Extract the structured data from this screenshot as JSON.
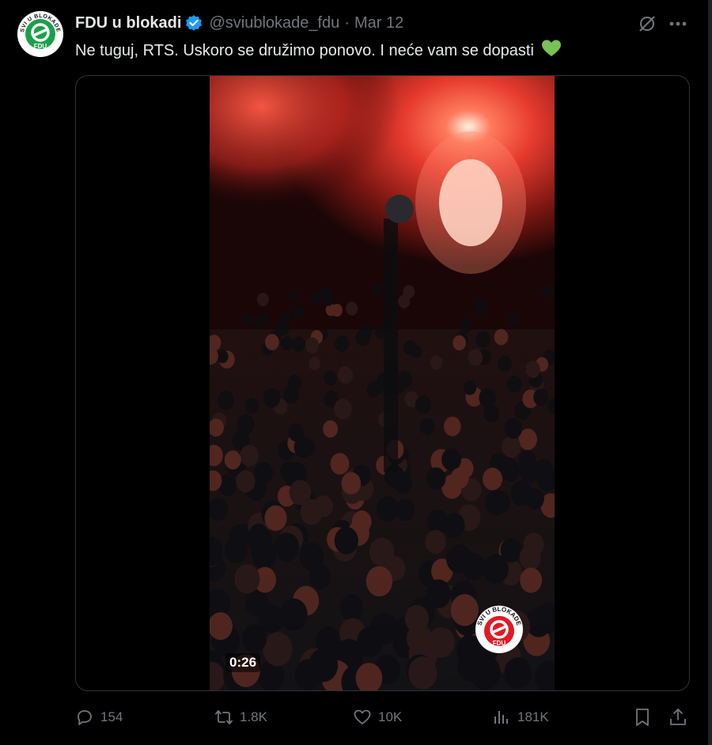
{
  "post": {
    "author_name": "FDU u blokadi",
    "handle": "@sviublokade_fdu",
    "separator": "·",
    "date": "Mar 12",
    "text": "Ne tuguj, RTS. Uskoro se družimo ponovo. I neće vam se dopasti",
    "emoji": "green-heart-icon"
  },
  "avatar": {
    "top_text": "SVI U BLOKADE",
    "bottom_text": "FDU"
  },
  "video": {
    "duration": "0:26",
    "watermark_top": "SVI U BLOKADE",
    "watermark_bottom": "FDU"
  },
  "actions": {
    "replies": "154",
    "reposts": "1.8K",
    "likes": "10K",
    "views": "181K"
  },
  "colors": {
    "background": "#000000",
    "text": "#e7e9ea",
    "muted": "#71767b",
    "verified": "#1d9bf0",
    "brand_green": "#1aa04a",
    "brand_red": "#e01b24",
    "heart": "#78c257"
  }
}
